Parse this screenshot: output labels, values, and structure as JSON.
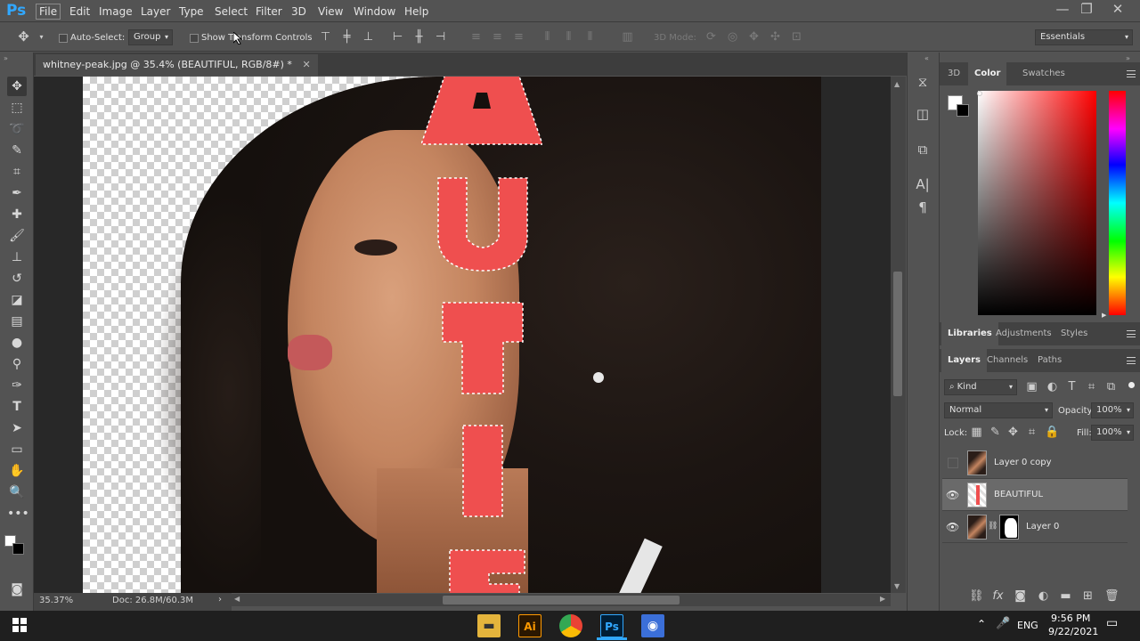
{
  "app": {
    "logo": "Ps"
  },
  "menu": [
    "File",
    "Edit",
    "Image",
    "Layer",
    "Type",
    "Select",
    "Filter",
    "3D",
    "View",
    "Window",
    "Help"
  ],
  "window_controls": {
    "minimize": "—",
    "restore": "❐",
    "close": "✕"
  },
  "options": {
    "auto_select_label": "Auto-Select:",
    "auto_select_value": "Group",
    "show_transform_label": "Show Transform Controls",
    "mode_3d_label": "3D Mode:",
    "workspace": "Essentials"
  },
  "document": {
    "tab_title": "whitney-peak.jpg @ 35.4% (BEAUTIFUL, RGB/8#) *",
    "tab_close": "✕",
    "canvas_text": [
      "A",
      "U",
      "T",
      "I",
      "F"
    ]
  },
  "status": {
    "zoom": "35.37%",
    "doc_size": "Doc: 26.8M/60.3M"
  },
  "color_panel": {
    "tabs": [
      "3D",
      "Color",
      "Swatches"
    ],
    "active_tab": "Color",
    "foreground": "#ffffff",
    "background": "#000000"
  },
  "libraries_panel": {
    "tabs": [
      "Libraries",
      "Adjustments",
      "Styles"
    ],
    "active_tab": "Libraries"
  },
  "layers_panel": {
    "tabs": [
      "Layers",
      "Channels",
      "Paths"
    ],
    "active_tab": "Layers",
    "filter_kind": "Kind",
    "blend_mode": "Normal",
    "opacity_label": "Opacity:",
    "opacity_value": "100%",
    "lock_label": "Lock:",
    "fill_label": "Fill:",
    "fill_value": "100%",
    "layers": [
      {
        "name": "Layer 0 copy",
        "visible": false,
        "selected": false
      },
      {
        "name": "BEAUTIFUL",
        "visible": true,
        "selected": true
      },
      {
        "name": "Layer 0",
        "visible": true,
        "selected": false
      }
    ]
  },
  "taskbar": {
    "time": "9:56 PM",
    "date": "9/22/2021",
    "language": "ENG",
    "accent": "#31a8ff"
  },
  "colors": {
    "text_fill": "#ef4f4f",
    "ps_blue": "#31a8ff"
  }
}
